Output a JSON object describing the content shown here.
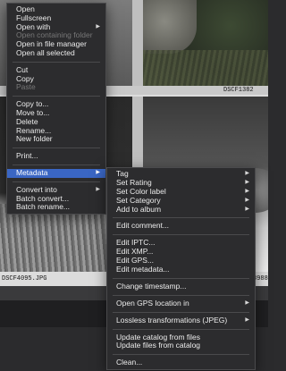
{
  "thumbnails": {
    "mid_right_caption": "DSCF1382",
    "bottom_left_caption": "DSCF4095.JPG",
    "bottom_right_caption": "8988"
  },
  "context_menu": {
    "items": [
      {
        "label": "Open",
        "enabled": true
      },
      {
        "label": "Fullscreen",
        "enabled": true
      },
      {
        "label": "Open with",
        "enabled": true,
        "submenu": true
      },
      {
        "label": "Open containing folder",
        "enabled": false
      },
      {
        "label": "Open in file manager",
        "enabled": true
      },
      {
        "label": "Open all selected",
        "enabled": true
      },
      {
        "label": "Cut",
        "enabled": true
      },
      {
        "label": "Copy",
        "enabled": true
      },
      {
        "label": "Paste",
        "enabled": false
      },
      {
        "label": "Copy to...",
        "enabled": true
      },
      {
        "label": "Move to...",
        "enabled": true
      },
      {
        "label": "Delete",
        "enabled": true
      },
      {
        "label": "Rename...",
        "enabled": true
      },
      {
        "label": "New folder",
        "enabled": true
      },
      {
        "label": "Print...",
        "enabled": true
      },
      {
        "label": "Metadata",
        "enabled": true,
        "submenu": true,
        "active": true
      },
      {
        "label": "Convert into",
        "enabled": true,
        "submenu": true
      },
      {
        "label": "Batch convert...",
        "enabled": true
      },
      {
        "label": "Batch rename...",
        "enabled": true
      }
    ]
  },
  "metadata_submenu": {
    "items": [
      {
        "label": "Tag",
        "submenu": true
      },
      {
        "label": "Set Rating",
        "submenu": true
      },
      {
        "label": "Set Color label",
        "submenu": true
      },
      {
        "label": "Set Category",
        "submenu": true
      },
      {
        "label": "Add to album",
        "submenu": true
      },
      {
        "label": "Edit comment..."
      },
      {
        "label": "Edit IPTC..."
      },
      {
        "label": "Edit XMP..."
      },
      {
        "label": "Edit GPS..."
      },
      {
        "label": "Edit metadata..."
      },
      {
        "label": "Change timestamp..."
      },
      {
        "label": "Open GPS location in",
        "submenu": true
      },
      {
        "label": "Lossless transformations (JPEG)",
        "submenu": true
      },
      {
        "label": "Update catalog from files"
      },
      {
        "label": "Update files from catalog"
      },
      {
        "label": "Clean..."
      }
    ]
  },
  "icons": {
    "submenu_arrow": "chevron-right-icon"
  },
  "colors": {
    "menu_bg": "#2c2c2e",
    "highlight": "#3a66c4"
  }
}
